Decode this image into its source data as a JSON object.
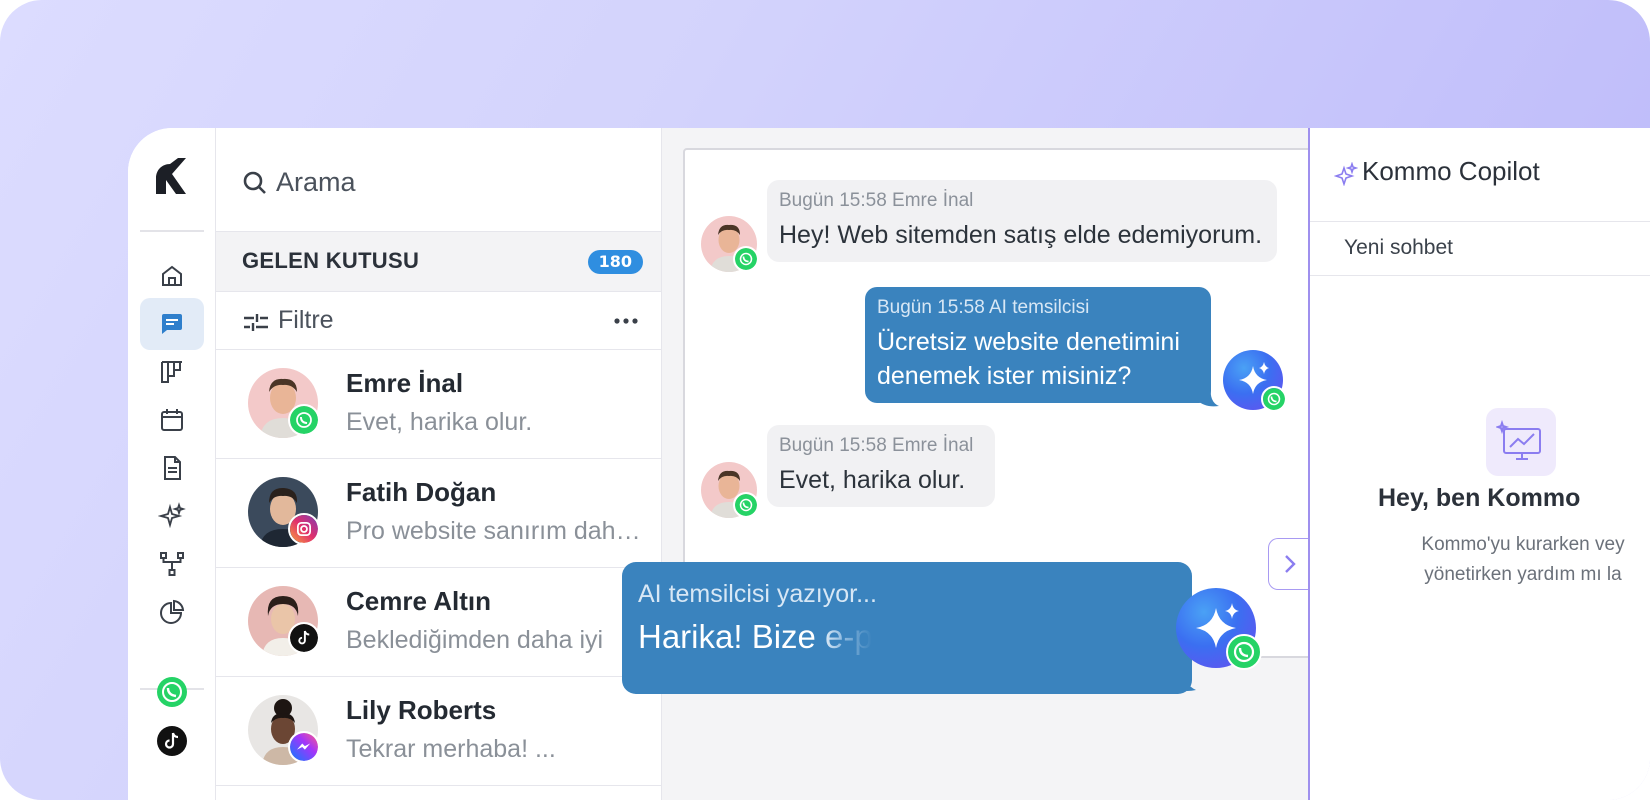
{
  "search": {
    "placeholder": "Arama"
  },
  "inbox": {
    "title": "GELEN KUTUSU",
    "count": "180",
    "filter_label": "Filtre",
    "conversations": [
      {
        "name": "Emre İnal",
        "preview": "Evet, harika olur.",
        "channel": "whatsapp"
      },
      {
        "name": "Fatih Doğan",
        "preview": "Pro website sanırım daha iyi olur",
        "channel": "instagram"
      },
      {
        "name": "Cemre Altın",
        "preview": "Beklediğimden daha iyi",
        "channel": "tiktok"
      },
      {
        "name": "Lily Roberts",
        "preview": "Tekrar merhaba! ...",
        "channel": "messenger"
      }
    ]
  },
  "chat": {
    "messages": [
      {
        "meta": "Bugün 15:58 Emre İnal",
        "text": "Hey! Web sitemden satış elde edemiyorum.",
        "direction": "in"
      },
      {
        "meta": "Bugün 15:58 AI temsilcisi",
        "text_line1": "Ücretsiz website denetimini",
        "text_line2": "denemek ister misiniz?",
        "direction": "out"
      },
      {
        "meta": "Bugün 15:58 Emre İnal",
        "text": "Evet, harika olur.",
        "direction": "in"
      }
    ],
    "typing": {
      "meta": "AI temsilcisi yazıyor...",
      "text": "Harika! Bize e-postanı"
    }
  },
  "copilot": {
    "title": "Kommo Copilot",
    "new_chat": "Yeni sohbet",
    "hello": "Hey, ben Kommo",
    "desc_line1": "Kommo'yu kurarken vey",
    "desc_line2": "yönetirken yardım mı la"
  },
  "colors": {
    "accent_blue": "#3a83be",
    "badge_blue": "#2f8ee0",
    "whatsapp": "#25d366",
    "copilot_border": "#9f90ee"
  },
  "icons": {
    "rail": [
      "home-icon",
      "chat-icon",
      "pipeline-icon",
      "calendar-icon",
      "document-icon",
      "sparkles-icon",
      "flow-icon",
      "chart-pie-icon"
    ],
    "channels": [
      "whatsapp-icon",
      "tiktok-icon"
    ]
  }
}
